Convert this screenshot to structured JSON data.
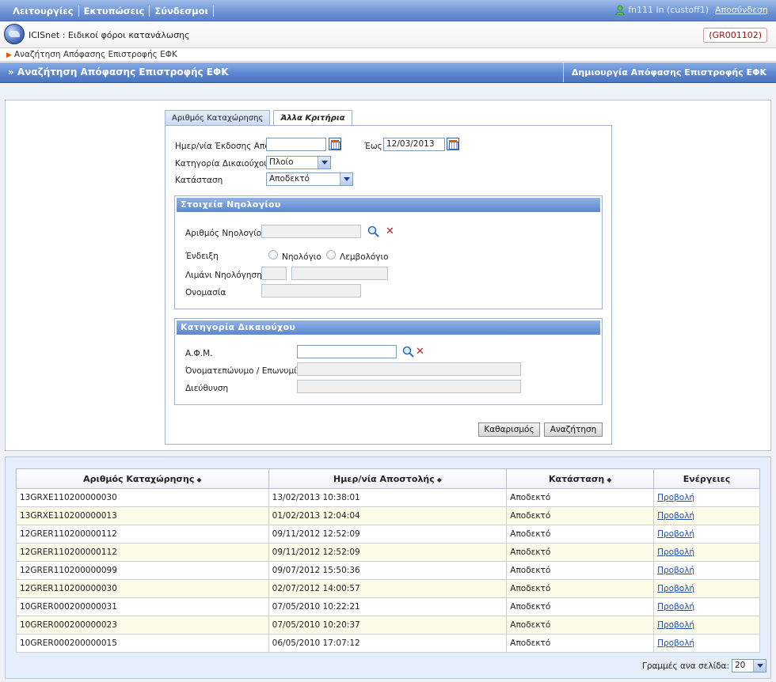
{
  "topmenu": {
    "items": [
      {
        "label": "Λειτουργίες"
      },
      {
        "label": "Εκτυπώσεις"
      },
      {
        "label": "Σύνδεσμοι"
      }
    ],
    "user": "fn111 ln (custoff1)",
    "logout": "Αποσύνδεση"
  },
  "app": {
    "title": "ICISnet : Ειδικοί φόροι κατανάλωσης",
    "office_code": "(GR001102)"
  },
  "breadcrumb": "Αναζήτηση Απόφασης Επιστροφής ΕΦΚ",
  "page": {
    "title": "» Αναζήτηση Απόφασης Επιστροφής ΕΦΚ",
    "create_action": "Δημιουργία Απόφασης Επιστροφής ΕΦΚ"
  },
  "tabs": [
    {
      "label": "Αριθμός Καταχώρησης",
      "active": false
    },
    {
      "label": "Άλλα Κριτήρια",
      "active": true
    }
  ],
  "form": {
    "date_from_label": "Ημερ/νία Έκδοσης Από",
    "date_from_value": "",
    "date_to_label": "Έως",
    "date_to_value": "12/03/2013",
    "beneficiary_category_label": "Κατηγορία Δικαιούχου",
    "beneficiary_category_value": "Πλοίο",
    "status_label": "Κατάσταση",
    "status_value": "Αποδεκτό",
    "registry_section": {
      "title": "Στοιχεία Νηολογίου",
      "registry_number_label": "Αριθμός Νηολογίου",
      "indication_label": "Ένδειξη",
      "radio_registry": "Νηολόγιο",
      "radio_boat_registry": "Λεμβολόγιο",
      "port_label": "Λιμάνι Νηολόγησης",
      "name_label": "Ονομασία"
    },
    "beneficiary_section": {
      "title": "Κατηγορία Δικαιούχου",
      "afm_label": "Α.Φ.Μ.",
      "fullname_label": "Όνοματεπώνυμο / Επωνυμία",
      "address_label": "Διεύθυνση"
    },
    "clear_button": "Καθαρισμός",
    "search_button": "Αναζήτηση"
  },
  "results": {
    "columns": [
      "Αριθμός Καταχώρησης",
      "Ημερ/νία Αποστολής",
      "Κατάσταση",
      "Ενέργειες"
    ],
    "rows": [
      {
        "number": "13GRXE110200000030",
        "date": "13/02/2013 10:38:01",
        "status": "Αποδεκτό",
        "action": "Προβολή"
      },
      {
        "number": "13GRXE110200000013",
        "date": "01/02/2013 12:04:04",
        "status": "Αποδεκτό",
        "action": "Προβολή"
      },
      {
        "number": "12GRER110200000112",
        "date": "09/11/2012 12:52:09",
        "status": "Αποδεκτό",
        "action": "Προβολή"
      },
      {
        "number": "12GRER110200000112",
        "date": "09/11/2012 12:52:09",
        "status": "Αποδεκτό",
        "action": "Προβολή"
      },
      {
        "number": "12GRER110200000099",
        "date": "09/07/2012 15:50:36",
        "status": "Αποδεκτό",
        "action": "Προβολή"
      },
      {
        "number": "12GRER110200000030",
        "date": "02/07/2012 14:00:57",
        "status": "Αποδεκτό",
        "action": "Προβολή"
      },
      {
        "number": "10GRER000200000031",
        "date": "07/05/2010 10:22:21",
        "status": "Αποδεκτό",
        "action": "Προβολή"
      },
      {
        "number": "10GRER000200000023",
        "date": "07/05/2010 10:20:37",
        "status": "Αποδεκτό",
        "action": "Προβολή"
      },
      {
        "number": "10GRER000200000015",
        "date": "06/05/2010 17:07:12",
        "status": "Αποδεκτό",
        "action": "Προβολή"
      }
    ],
    "rows_per_page_label": "Γραμμές ανα σελίδα:",
    "rows_per_page_value": "20"
  },
  "colors": {
    "header_blue": "#5c86cf",
    "office_code_red": "#a01010",
    "link_blue": "#1f4fb5",
    "alt_row": "#fcfce8"
  }
}
